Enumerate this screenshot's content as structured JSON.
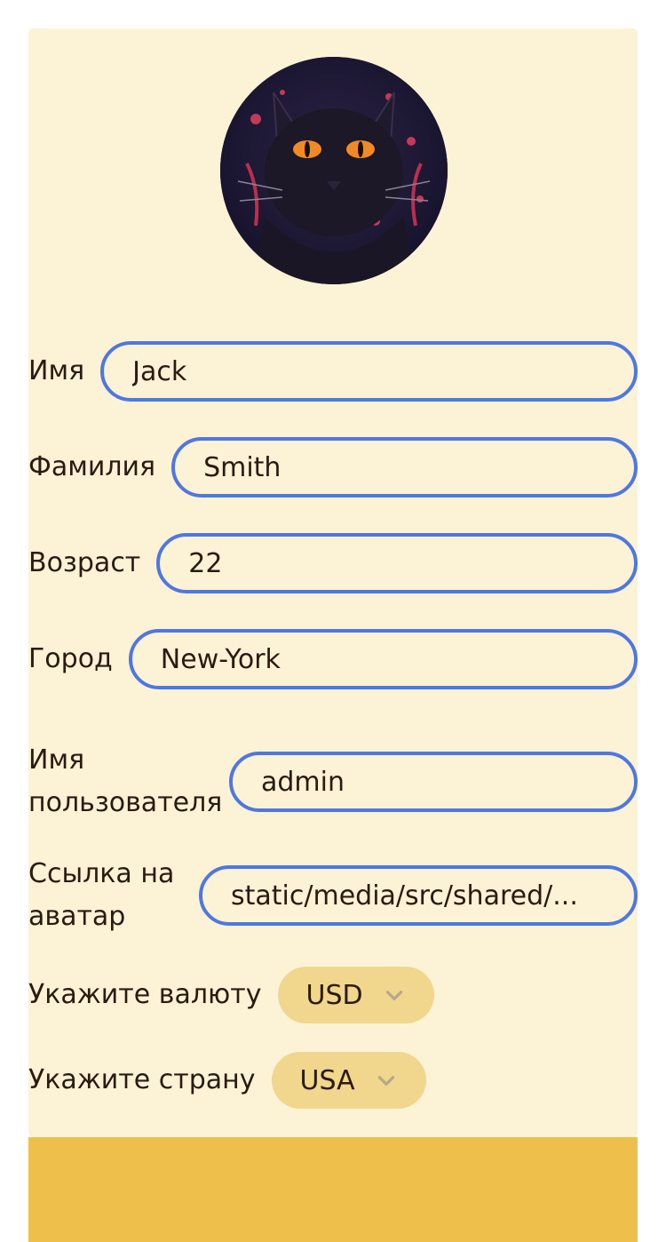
{
  "profile": {
    "avatar_icon": "black-cat-portrait",
    "fields": [
      {
        "label": "Имя",
        "value": "Jack"
      },
      {
        "label": "Фамилия",
        "value": "Smith"
      },
      {
        "label": "Возраст",
        "value": "22"
      },
      {
        "label": "Город",
        "value": "New-York"
      },
      {
        "label": "Имя пользователя",
        "value": "admin"
      },
      {
        "label": "Ссылка на аватар",
        "value": "static/media/src/shared/..."
      }
    ],
    "currency": {
      "label": "Укажите валюту",
      "value": "USD"
    },
    "country": {
      "label": "Укажите страну",
      "value": "USA"
    }
  },
  "colors": {
    "card_bg": "#fcf2d5",
    "input_border": "#4f77e2",
    "select_bg": "#f1d68d",
    "footer_bg": "#eec04b"
  }
}
